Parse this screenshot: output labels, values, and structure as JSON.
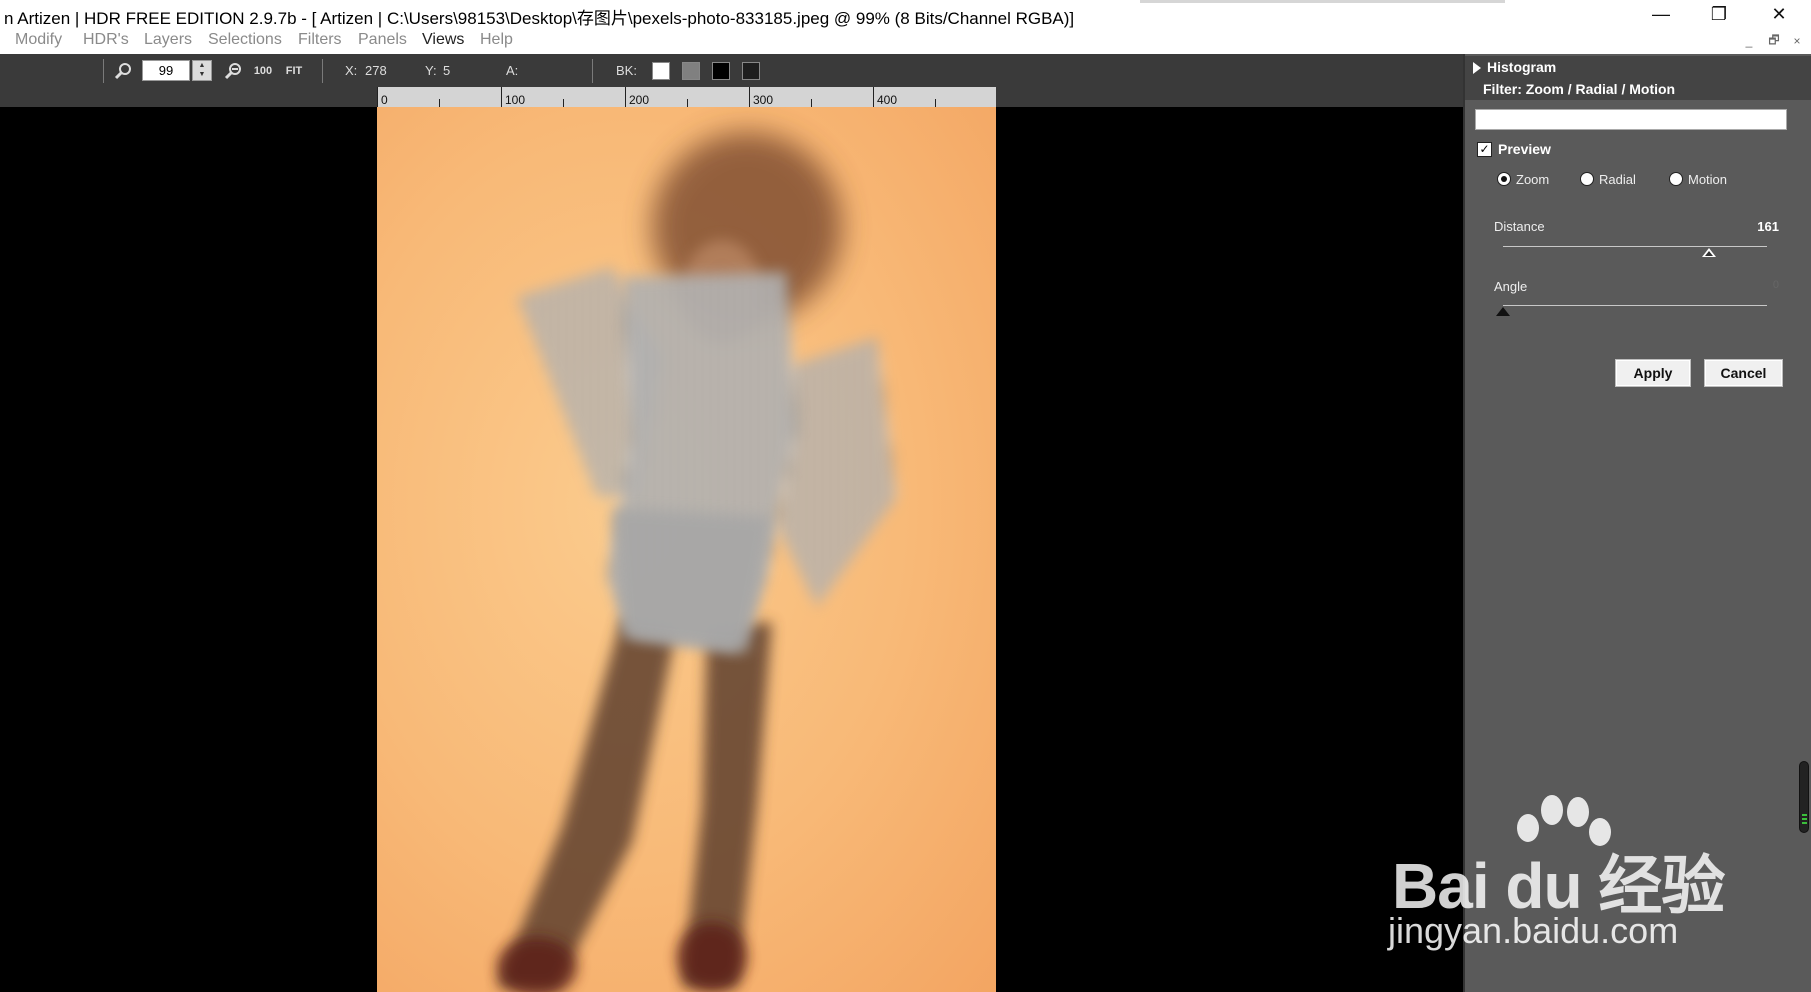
{
  "window": {
    "title": "n Artizen | HDR FREE EDITION 2.9.7b - [  Artizen | C:\\Users\\98153\\Desktop\\存图片\\pexels-photo-833185.jpeg @ 99% (8 Bits/Channel RGBA)]",
    "minimize_glyph": "—",
    "maximize_glyph": "❐",
    "close_glyph": "✕"
  },
  "menu": {
    "items": [
      {
        "label": "Modify",
        "active": false
      },
      {
        "label": "HDR's",
        "active": false
      },
      {
        "label": "Layers",
        "active": false
      },
      {
        "label": "Selections",
        "active": false
      },
      {
        "label": "Filters",
        "active": false
      },
      {
        "label": "Panels",
        "active": false
      },
      {
        "label": "Views",
        "active": true
      },
      {
        "label": "Help",
        "active": false
      }
    ],
    "mdi": {
      "minimize": "_",
      "restore": "🗗",
      "close": "×"
    }
  },
  "toolbar": {
    "zoom_value": "99",
    "zoom100_label": "100",
    "fit_label": "FIT",
    "x_label": "X:",
    "x_value": "278",
    "y_label": "Y:",
    "y_value": "5",
    "a_label": "A:",
    "a_value": "",
    "bk_label": "BK:",
    "bk_swatches": [
      "#ffffff",
      "#808080",
      "#000000",
      "#1e1e1e"
    ]
  },
  "ruler": {
    "labels": [
      "0",
      "100",
      "200",
      "300",
      "400"
    ]
  },
  "panel": {
    "histogram_title": "Histogram",
    "filter_title": "Filter: Zoom / Radial / Motion",
    "filter_name_value": "",
    "preview": {
      "label": "Preview",
      "checked": true
    },
    "modes": [
      {
        "label": "Zoom",
        "selected": true
      },
      {
        "label": "Radial",
        "selected": false
      },
      {
        "label": "Motion",
        "selected": false
      }
    ],
    "distance": {
      "label": "Distance",
      "value": "161",
      "fraction": 0.78
    },
    "angle": {
      "label": "Angle",
      "value": "0",
      "fraction": 0.0
    },
    "apply_label": "Apply",
    "cancel_label": "Cancel"
  },
  "watermark": {
    "line1": "Bai du 经验",
    "line2": "jingyan.baidu.com"
  },
  "colors": {
    "toolbar_bg": "#3a3a3a",
    "panel_bg": "#5a5a5a",
    "panel_header_bg": "#444444",
    "photo_bg": "#f8b977"
  }
}
